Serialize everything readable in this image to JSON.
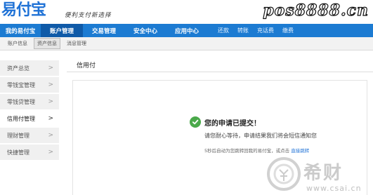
{
  "header": {
    "logo": "易付宝",
    "slogan": "便利支付新选择",
    "watermark": "pos8888.cn"
  },
  "nav": {
    "items": [
      {
        "label": "我的易付宝",
        "active": false
      },
      {
        "label": "账户管理",
        "active": true
      },
      {
        "label": "交易管理",
        "active": false
      },
      {
        "label": "安全中心",
        "active": false
      },
      {
        "label": "应用中心",
        "active": false
      }
    ],
    "quick_links": [
      "还款",
      "转账",
      "充话费",
      "缴费"
    ]
  },
  "subnav": {
    "items": [
      {
        "label": "账户信息",
        "active": false
      },
      {
        "label": "资产信息",
        "active": true
      },
      {
        "label": "消息管理",
        "active": false
      }
    ]
  },
  "sidebar": {
    "items": [
      {
        "label": "资产总览",
        "active": false
      },
      {
        "label": "零钱宝管理",
        "active": false
      },
      {
        "label": "零钱贷管理",
        "active": false
      },
      {
        "label": "信用付管理",
        "active": true
      },
      {
        "label": "理财管理",
        "active": false
      },
      {
        "label": "快捷管理",
        "active": false
      }
    ]
  },
  "content": {
    "title": "信用付",
    "message_title": "您的申请已提交！",
    "message_sub": "请您耐心等待，申请结果我们将会短信通知您",
    "redirect_text": "5秒后自动为您跳转回我的易付宝，或点击",
    "redirect_link": "直接跳转"
  },
  "watermark_bottom": {
    "brand": "希财",
    "site": "www.csai.cn"
  },
  "colors": {
    "nav_bg": "#1c7bd2",
    "nav_active": "#0f5aa8",
    "success": "#4aa94a",
    "link": "#1f72d6"
  }
}
